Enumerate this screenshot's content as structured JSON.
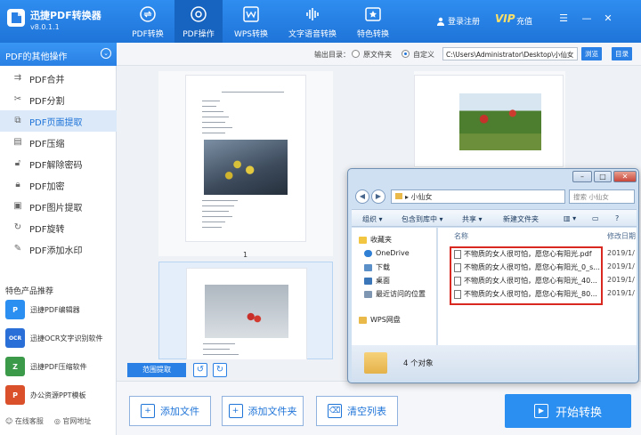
{
  "app": {
    "title": "迅捷PDF转换器",
    "version": "v8.0.1.1"
  },
  "nav": {
    "tabs": [
      {
        "label": "PDF转换",
        "icon": "convert-icon"
      },
      {
        "label": "PDF操作",
        "icon": "gear-icon",
        "active": true
      },
      {
        "label": "WPS转换",
        "icon": "wps-icon"
      },
      {
        "label": "文字语音转换",
        "icon": "audio-wave-icon"
      },
      {
        "label": "特色转换",
        "icon": "star-icon"
      }
    ],
    "login": "登录注册",
    "vip": "VIP",
    "recharge": "充值"
  },
  "sidebar": {
    "header": "PDF的其他操作",
    "items": [
      {
        "label": "PDF合并",
        "icon": "merge-icon"
      },
      {
        "label": "PDF分割",
        "icon": "scissors-icon"
      },
      {
        "label": "PDF页面提取",
        "icon": "extract-icon",
        "active": true
      },
      {
        "label": "PDF压缩",
        "icon": "compress-icon"
      },
      {
        "label": "PDF解除密码",
        "icon": "unlock-icon"
      },
      {
        "label": "PDF加密",
        "icon": "lock-icon"
      },
      {
        "label": "PDF图片提取",
        "icon": "image-icon"
      },
      {
        "label": "PDF旋转",
        "icon": "rotate-icon"
      },
      {
        "label": "PDF添加水印",
        "icon": "watermark-icon"
      }
    ],
    "featured_title": "特色产品推荐",
    "products": [
      {
        "label": "迅捷PDF编辑器",
        "badge": "P",
        "color": "#2a8ff0"
      },
      {
        "label": "迅捷OCR文字识别软件",
        "badge": "OCR",
        "color": "#2a6fd8"
      },
      {
        "label": "迅捷PDF压缩软件",
        "badge": "Z",
        "color": "#3a9a4a"
      },
      {
        "label": "办公资源PPT模板",
        "badge": "P",
        "color": "#d9502a"
      }
    ],
    "footer_service": "在线客服",
    "footer_site": "官网地址"
  },
  "output": {
    "label": "输出目录：",
    "option_source": "原文件夹",
    "option_custom": "自定义",
    "path": "C:\\Users\\Administrator\\Desktop\\小仙女",
    "browse": "浏览",
    "open_dir": "目录"
  },
  "preview": {
    "page1_number": "1"
  },
  "toolbar": {
    "range_extract": "范围提取",
    "add_file": "添加文件",
    "add_folder": "添加文件夹",
    "clear_list": "清空列表",
    "start": "开始转换"
  },
  "explorer": {
    "address": "小仙女",
    "search_placeholder": "搜索 小仙女",
    "tb_organize": "组织 ▾",
    "tb_include": "包含到库中 ▾",
    "tb_share": "共享 ▾",
    "tb_newfolder": "新建文件夹",
    "nav_items": [
      "收藏夹",
      "OneDrive",
      "下载",
      "桌面",
      "最近访问的位置",
      "WPS网盘"
    ],
    "col_name": "名称",
    "col_date": "修改日期",
    "files": [
      {
        "name": "不物质的女人很可怕，愿您心有阳光.pdf",
        "date": "2019/1/"
      },
      {
        "name": "不物质的女人很可怕，愿您心有阳光_0_s...",
        "date": "2019/1/"
      },
      {
        "name": "不物质的女人很可怕，愿您心有阳光_40...",
        "date": "2019/1/"
      },
      {
        "name": "不物质的女人很可怕，愿您心有阳光_80...",
        "date": "2019/1/"
      }
    ],
    "status": "4 个对象"
  }
}
